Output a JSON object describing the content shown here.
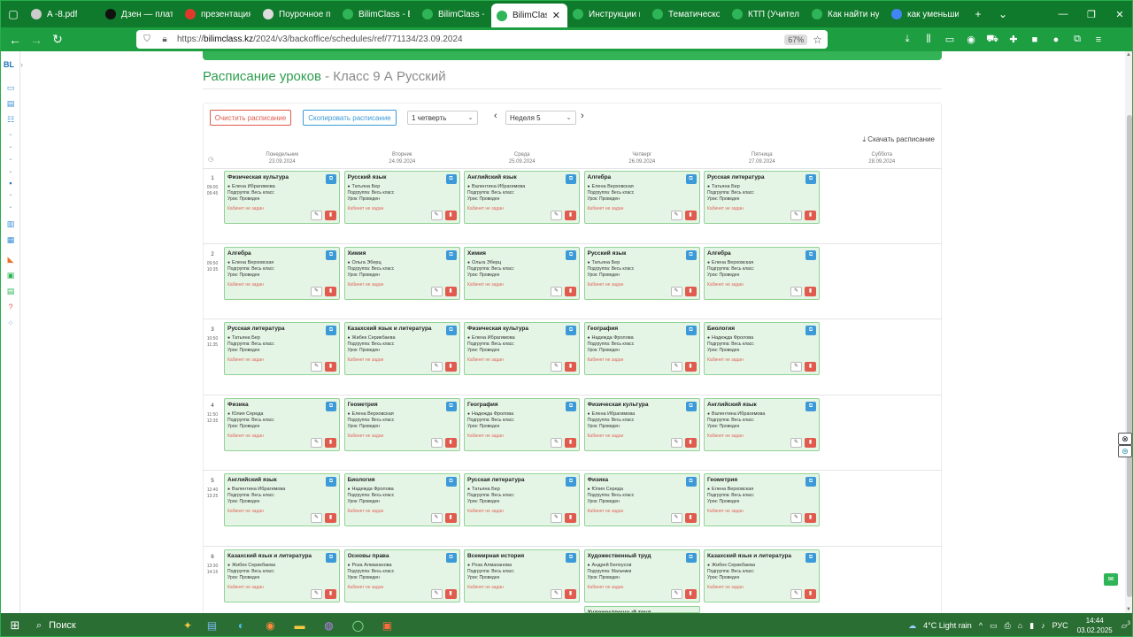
{
  "browser": {
    "tabs": [
      {
        "title": "A -8.pdf",
        "favicon_color": "#cccccc",
        "active": false
      },
      {
        "title": "Дзен — платфор",
        "favicon_color": "#111111",
        "active": false
      },
      {
        "title": "презентация Ко",
        "favicon_color": "#e0392b",
        "active": false
      },
      {
        "title": "Поурочное пла",
        "favicon_color": "#dddddd",
        "active": false
      },
      {
        "title": "BilimClass - Bilim",
        "favicon_color": "#2fb558",
        "active": false
      },
      {
        "title": "BilimClass - Bilim",
        "favicon_color": "#2fb558",
        "active": false
      },
      {
        "title": "BilimClass - Bi",
        "favicon_color": "#2fb558",
        "active": true
      },
      {
        "title": "Инструкции к на",
        "favicon_color": "#2fb558",
        "active": false
      },
      {
        "title": "Тематическое п",
        "favicon_color": "#2fb558",
        "active": false
      },
      {
        "title": "КТП (Учитель)",
        "favicon_color": "#2fb558",
        "active": false
      },
      {
        "title": "Как найти нужн",
        "favicon_color": "#2fb558",
        "active": false
      },
      {
        "title": "как уменьшить",
        "favicon_color": "#4285f4",
        "active": false
      }
    ],
    "new_tab": "+",
    "tab_list": "⌄",
    "url_prefix": "https://",
    "url_domain": "bilimclass.kz",
    "url_path": "/2024/v3/backoffice/schedules/ref/771134/23.09.2024",
    "zoom": "67%"
  },
  "page": {
    "title_main": "Расписание уроков",
    "title_sub": " - Класс 9 А Русский",
    "clear_button": "Очистить расписание",
    "copy_button": "Скопировать расписание",
    "quarter_select": "1 четверть",
    "week_select": "Неделя 5",
    "prev_arrow": "‹",
    "next_arrow": "›",
    "download": "⤓  Скачать расписание",
    "clock_icon": "◷"
  },
  "days": [
    {
      "name": "Понедельник",
      "date": "23.09.2024"
    },
    {
      "name": "Вторник",
      "date": "24.09.2024"
    },
    {
      "name": "Среда",
      "date": "25.09.2024"
    },
    {
      "name": "Четверг",
      "date": "26.09.2024"
    },
    {
      "name": "Пятница",
      "date": "27.09.2024"
    },
    {
      "name": "Суббота",
      "date": "28.09.2024"
    }
  ],
  "periods": [
    {
      "num": "1",
      "start": "09:00",
      "end": "09:45"
    },
    {
      "num": "2",
      "start": "09:50",
      "end": "10:35"
    },
    {
      "num": "3",
      "start": "10:50",
      "end": "11:35"
    },
    {
      "num": "4",
      "start": "11:50",
      "end": "12:35"
    },
    {
      "num": "5",
      "start": "12:40",
      "end": "13:25"
    },
    {
      "num": "6",
      "start": "13:30",
      "end": "14:15"
    }
  ],
  "labels": {
    "subgroup": "Подгруппа: ",
    "lesson": "Урок: ",
    "room_missing": "Кабинет не задан"
  },
  "lessons": [
    [
      {
        "subject": "Физическая культура",
        "teacher": "Елена Ибрагимова",
        "subgroup": "Весь класс",
        "status": "Проведен"
      },
      {
        "subject": "Русский язык",
        "teacher": "Татьяна Бер",
        "subgroup": "Весь класс",
        "status": "Проведен"
      },
      {
        "subject": "Английский язык",
        "teacher": "Валентина Ибрагимова",
        "subgroup": "Весь класс",
        "status": "Проведен"
      },
      {
        "subject": "Алгебра",
        "teacher": "Елена Верховская",
        "subgroup": "Весь класс",
        "status": "Проведен"
      },
      {
        "subject": "Русская литература",
        "teacher": "Татьяна Бер",
        "subgroup": "Весь класс",
        "status": "Проведен"
      }
    ],
    [
      {
        "subject": "Алгебра",
        "teacher": "Елена Верховская",
        "subgroup": "Весь класс",
        "status": "Проведен"
      },
      {
        "subject": "Химия",
        "teacher": "Ольга Эберц",
        "subgroup": "Весь класс",
        "status": "Проведен"
      },
      {
        "subject": "Химия",
        "teacher": "Ольга Эберц",
        "subgroup": "Весь класс",
        "status": "Проведен"
      },
      {
        "subject": "Русский язык",
        "teacher": "Татьяна Бер",
        "subgroup": "Весь класс",
        "status": "Проведен"
      },
      {
        "subject": "Алгебра",
        "teacher": "Елена Верховская",
        "subgroup": "Весь класс",
        "status": "Проведен"
      }
    ],
    [
      {
        "subject": "Русская литература",
        "teacher": "Татьяна Бер",
        "subgroup": "Весь класс",
        "status": "Проведен"
      },
      {
        "subject": "Казахский язык и литература",
        "teacher": "Жибек Серикбаева",
        "subgroup": "Весь класс",
        "status": "Проведен"
      },
      {
        "subject": "Физическая культура",
        "teacher": "Елена Ибрагимова",
        "subgroup": "Весь класс",
        "status": "Проведен"
      },
      {
        "subject": "География",
        "teacher": "Надежда Фролова",
        "subgroup": "Весь класс",
        "status": "Проведен"
      },
      {
        "subject": "Биология",
        "teacher": "Надежда Фролова",
        "subgroup": "Весь класс",
        "status": "Проведен"
      }
    ],
    [
      {
        "subject": "Физика",
        "teacher": "Юлия Середа",
        "subgroup": "Весь класс",
        "status": "Проведен"
      },
      {
        "subject": "Геометрия",
        "teacher": "Елена Верховская",
        "subgroup": "Весь класс",
        "status": "Проведен"
      },
      {
        "subject": "География",
        "teacher": "Надежда Фролова",
        "subgroup": "Весь класс",
        "status": "Проведен"
      },
      {
        "subject": "Физическая культура",
        "teacher": "Елена Ибрагимова",
        "subgroup": "Весь класс",
        "status": "Проведен"
      },
      {
        "subject": "Английский язык",
        "teacher": "Валентина Ибрагимова",
        "subgroup": "Весь класс",
        "status": "Проведен"
      }
    ],
    [
      {
        "subject": "Английский язык",
        "teacher": "Валентина Ибрагимова",
        "subgroup": "Весь класс",
        "status": "Проведен"
      },
      {
        "subject": "Биология",
        "teacher": "Надежда Фролова",
        "subgroup": "Весь класс",
        "status": "Проведен"
      },
      {
        "subject": "Русская литература",
        "teacher": "Татьяна Бер",
        "subgroup": "Весь класс",
        "status": "Проведен"
      },
      {
        "subject": "Физика",
        "teacher": "Юлия Середа",
        "subgroup": "Весь класс",
        "status": "Проведен"
      },
      {
        "subject": "Геометрия",
        "teacher": "Елена Верховская",
        "subgroup": "Весь класс",
        "status": "Проведен"
      }
    ],
    [
      {
        "subject": "Казахский язык и литература",
        "teacher": "Жибек Серикбаева",
        "subgroup": "Весь класс",
        "status": "Проведен"
      },
      {
        "subject": "Основы права",
        "teacher": "Роза Алмаханова",
        "subgroup": "Весь класс",
        "status": "Проведен"
      },
      {
        "subject": "Всемирная история",
        "teacher": "Роза Алмаханова",
        "subgroup": "Весь класс",
        "status": "Проведен"
      },
      {
        "subject": "Художественный труд",
        "teacher": "Андрей Белоусов",
        "subgroup": "Мальчики",
        "status": "Проведен"
      },
      {
        "subject": "Казахский язык и литература",
        "teacher": "Жибек Серикбаева",
        "subgroup": "Весь класс",
        "status": "Проведен"
      }
    ]
  ],
  "extra_lesson": {
    "subject": "Художественный труд"
  },
  "taskbar": {
    "search": "Поиск",
    "weather": "4°C  Light rain",
    "lang": "РУС",
    "time": "14:44",
    "date": "03.02.2025",
    "badge": "3"
  },
  "rail": {
    "logo": "BL"
  }
}
